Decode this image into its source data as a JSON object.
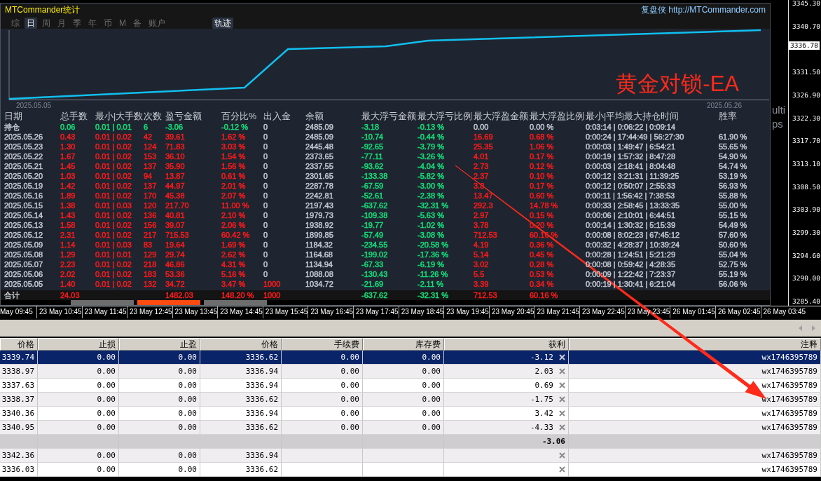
{
  "window": {
    "title": "MTCommander统计",
    "brand": "复盘侠 http://MTCommander.com"
  },
  "tabs": [
    {
      "label": "综",
      "selected": false
    },
    {
      "label": "日",
      "selected": true
    },
    {
      "label": "周",
      "selected": false
    },
    {
      "label": "月",
      "selected": false
    },
    {
      "label": "季",
      "selected": false
    },
    {
      "label": "年",
      "selected": false
    },
    {
      "label": "币",
      "selected": false
    },
    {
      "label": "M",
      "selected": false
    },
    {
      "label": "备",
      "selected": false
    },
    {
      "label": "账户",
      "selected": false
    }
  ],
  "view_tabs": [
    {
      "label": "轨迹",
      "selected": true
    }
  ],
  "equity_chart": {
    "start_label": "2025.05.05",
    "end_label": "2025.05.26",
    "overlay_text": "黄金对锁-EA"
  },
  "stats": {
    "columns": [
      "日期",
      "总手数",
      "最小|大手数",
      "次数",
      "盈亏金额",
      "百分比%",
      "出入金",
      "余额",
      "最大浮亏金额",
      "最大浮亏比例",
      "最大浮盈金额",
      "最大浮盈比例",
      "最小|平均最大持仓时间",
      "胜率"
    ],
    "rows": [
      {
        "kind": "holding",
        "cells": [
          "持仓",
          {
            "text": "0.06",
            "color": "#14e07a"
          },
          {
            "text": "0.01 | 0.01",
            "color": "#14e07a"
          },
          {
            "text": "6",
            "color": "#14e07a"
          },
          {
            "text": "-3.06",
            "color": "#14e07a"
          },
          {
            "text": "-0.12 %",
            "color": "#14e07a"
          },
          "0",
          "2485.09",
          {
            "text": "-3.18",
            "color": "#14e07a"
          },
          {
            "text": "-0.13 %",
            "color": "#14e07a"
          },
          "0.00",
          "0.00 %",
          "0:03:14 | 0:06:22 | 0:09:14"
        ]
      },
      {
        "kind": "day",
        "cells": [
          "2025.05.26",
          {
            "text": "0.43",
            "color": "#ff1a1a"
          },
          {
            "text": "0.01 | 0.02",
            "color": "#ff1a1a"
          },
          {
            "text": "42",
            "color": "#ff1a1a"
          },
          {
            "text": "39.61",
            "color": "#ff1a1a"
          },
          {
            "text": "1.62 %",
            "color": "#ff1a1a"
          },
          "0",
          "2485.09",
          {
            "text": "-10.74",
            "color": "#14e07a"
          },
          {
            "text": "-0.44 %",
            "color": "#14e07a"
          },
          {
            "text": "16.69",
            "color": "#ff1a1a"
          },
          {
            "text": "0.68 %",
            "color": "#ff1a1a"
          },
          "0:00:24 | 17:44:49 | 56:27:30",
          "61.90 %"
        ]
      },
      {
        "kind": "day",
        "cells": [
          "2025.05.23",
          {
            "text": "1.30",
            "color": "#ff1a1a"
          },
          {
            "text": "0.01 | 0.02",
            "color": "#ff1a1a"
          },
          {
            "text": "124",
            "color": "#ff1a1a"
          },
          {
            "text": "71.83",
            "color": "#ff1a1a"
          },
          {
            "text": "3.03 %",
            "color": "#ff1a1a"
          },
          "0",
          "2445.48",
          {
            "text": "-92.65",
            "color": "#14e07a"
          },
          {
            "text": "-3.79 %",
            "color": "#14e07a"
          },
          {
            "text": "25.35",
            "color": "#ff1a1a"
          },
          {
            "text": "1.06 %",
            "color": "#ff1a1a"
          },
          "0:00:03 | 1:49:47 | 6:54:21",
          "55.65 %"
        ]
      },
      {
        "kind": "day",
        "cells": [
          "2025.05.22",
          {
            "text": "1.67",
            "color": "#ff1a1a"
          },
          {
            "text": "0.01 | 0.02",
            "color": "#ff1a1a"
          },
          {
            "text": "153",
            "color": "#ff1a1a"
          },
          {
            "text": "36.10",
            "color": "#ff1a1a"
          },
          {
            "text": "1.54 %",
            "color": "#ff1a1a"
          },
          "0",
          "2373.65",
          {
            "text": "-77.11",
            "color": "#14e07a"
          },
          {
            "text": "-3.26 %",
            "color": "#14e07a"
          },
          {
            "text": "4.01",
            "color": "#ff1a1a"
          },
          {
            "text": "0.17 %",
            "color": "#ff1a1a"
          },
          "0:00:19 | 1:57:32 | 8:47:28",
          "54.90 %"
        ]
      },
      {
        "kind": "day",
        "cells": [
          "2025.05.21",
          {
            "text": "1.45",
            "color": "#ff1a1a"
          },
          {
            "text": "0.01 | 0.02",
            "color": "#ff1a1a"
          },
          {
            "text": "137",
            "color": "#ff1a1a"
          },
          {
            "text": "35.90",
            "color": "#ff1a1a"
          },
          {
            "text": "1.56 %",
            "color": "#ff1a1a"
          },
          "0",
          "2337.55",
          {
            "text": "-93.62",
            "color": "#14e07a"
          },
          {
            "text": "-4.04 %",
            "color": "#14e07a"
          },
          {
            "text": "2.73",
            "color": "#ff1a1a"
          },
          {
            "text": "0.12 %",
            "color": "#ff1a1a"
          },
          "0:00:03 | 2:18:41 | 8:04:48",
          "54.74 %"
        ]
      },
      {
        "kind": "day",
        "cells": [
          "2025.05.20",
          {
            "text": "1.03",
            "color": "#ff1a1a"
          },
          {
            "text": "0.01 | 0.02",
            "color": "#ff1a1a"
          },
          {
            "text": "94",
            "color": "#ff1a1a"
          },
          {
            "text": "13.87",
            "color": "#ff1a1a"
          },
          {
            "text": "0.61 %",
            "color": "#ff1a1a"
          },
          "0",
          "2301.65",
          {
            "text": "-133.38",
            "color": "#14e07a"
          },
          {
            "text": "-5.82 %",
            "color": "#14e07a"
          },
          {
            "text": "2.37",
            "color": "#ff1a1a"
          },
          {
            "text": "0.10 %",
            "color": "#ff1a1a"
          },
          "0:00:12 | 3:21:31 | 11:39:25",
          "53.19 %"
        ]
      },
      {
        "kind": "day",
        "cells": [
          "2025.05.19",
          {
            "text": "1.42",
            "color": "#ff1a1a"
          },
          {
            "text": "0.01 | 0.02",
            "color": "#ff1a1a"
          },
          {
            "text": "137",
            "color": "#ff1a1a"
          },
          {
            "text": "44.97",
            "color": "#ff1a1a"
          },
          {
            "text": "2.01 %",
            "color": "#ff1a1a"
          },
          "0",
          "2287.78",
          {
            "text": "-67.59",
            "color": "#14e07a"
          },
          {
            "text": "-3.00 %",
            "color": "#14e07a"
          },
          {
            "text": "3.8",
            "color": "#ff1a1a"
          },
          {
            "text": "0.17 %",
            "color": "#ff1a1a"
          },
          "0:00:12 | 0:50:07 | 2:55:33",
          "56.93 %"
        ]
      },
      {
        "kind": "day",
        "cells": [
          "2025.05.16",
          {
            "text": "1.89",
            "color": "#ff1a1a"
          },
          {
            "text": "0.01 | 0.02",
            "color": "#ff1a1a"
          },
          {
            "text": "170",
            "color": "#ff1a1a"
          },
          {
            "text": "45.38",
            "color": "#ff1a1a"
          },
          {
            "text": "2.07 %",
            "color": "#ff1a1a"
          },
          "0",
          "2242.81",
          {
            "text": "-52.61",
            "color": "#14e07a"
          },
          {
            "text": "-2.38 %",
            "color": "#14e07a"
          },
          {
            "text": "13.47",
            "color": "#ff1a1a"
          },
          {
            "text": "0.60 %",
            "color": "#ff1a1a"
          },
          "0:00:11 | 1:56:42 | 7:38:53",
          "55.88 %"
        ]
      },
      {
        "kind": "day",
        "cells": [
          "2025.05.15",
          {
            "text": "1.38",
            "color": "#ff1a1a"
          },
          {
            "text": "0.01 | 0.03",
            "color": "#ff1a1a"
          },
          {
            "text": "120",
            "color": "#ff1a1a"
          },
          {
            "text": "217.70",
            "color": "#ff1a1a"
          },
          {
            "text": "11.00 %",
            "color": "#ff1a1a"
          },
          "0",
          "2197.43",
          {
            "text": "-637.62",
            "color": "#14e07a"
          },
          {
            "text": "-32.31 %",
            "color": "#14e07a"
          },
          {
            "text": "292.3",
            "color": "#ff1a1a"
          },
          {
            "text": "14.78 %",
            "color": "#ff1a1a"
          },
          "0:00:33 | 2:58:45 | 13:33:35",
          "55.00 %"
        ]
      },
      {
        "kind": "day",
        "cells": [
          "2025.05.14",
          {
            "text": "1.43",
            "color": "#ff1a1a"
          },
          {
            "text": "0.01 | 0.02",
            "color": "#ff1a1a"
          },
          {
            "text": "136",
            "color": "#ff1a1a"
          },
          {
            "text": "40.81",
            "color": "#ff1a1a"
          },
          {
            "text": "2.10 %",
            "color": "#ff1a1a"
          },
          "0",
          "1979.73",
          {
            "text": "-109.38",
            "color": "#14e07a"
          },
          {
            "text": "-5.63 %",
            "color": "#14e07a"
          },
          {
            "text": "2.97",
            "color": "#ff1a1a"
          },
          {
            "text": "0.15 %",
            "color": "#ff1a1a"
          },
          "0:00:06 | 2:10:01 | 6:44:51",
          "55.15 %"
        ]
      },
      {
        "kind": "day",
        "cells": [
          "2025.05.13",
          {
            "text": "1.58",
            "color": "#ff1a1a"
          },
          {
            "text": "0.01 | 0.02",
            "color": "#ff1a1a"
          },
          {
            "text": "156",
            "color": "#ff1a1a"
          },
          {
            "text": "39.07",
            "color": "#ff1a1a"
          },
          {
            "text": "2.06 %",
            "color": "#ff1a1a"
          },
          "0",
          "1938.92",
          {
            "text": "-19.77",
            "color": "#14e07a"
          },
          {
            "text": "-1.02 %",
            "color": "#14e07a"
          },
          {
            "text": "3.78",
            "color": "#ff1a1a"
          },
          {
            "text": "0.20 %",
            "color": "#ff1a1a"
          },
          "0:00:14 | 1:30:32 | 5:15:39",
          "54.49 %"
        ]
      },
      {
        "kind": "day",
        "cells": [
          "2025.05.12",
          {
            "text": "2.31",
            "color": "#ff1a1a"
          },
          {
            "text": "0.01 | 0.02",
            "color": "#ff1a1a"
          },
          {
            "text": "217",
            "color": "#ff1a1a"
          },
          {
            "text": "715.53",
            "color": "#ff1a1a"
          },
          {
            "text": "60.42 %",
            "color": "#ff1a1a"
          },
          "0",
          "1899.85",
          {
            "text": "-57.49",
            "color": "#14e07a"
          },
          {
            "text": "-3.08 %",
            "color": "#14e07a"
          },
          {
            "text": "712.53",
            "color": "#ff1a1a"
          },
          {
            "text": "60.16 %",
            "color": "#ff1a1a"
          },
          "0:00:08 | 8:02:23 | 67:45:12",
          "57.60 %"
        ]
      },
      {
        "kind": "day",
        "cells": [
          "2025.05.09",
          {
            "text": "1.14",
            "color": "#ff1a1a"
          },
          {
            "text": "0.01 | 0.03",
            "color": "#ff1a1a"
          },
          {
            "text": "83",
            "color": "#ff1a1a"
          },
          {
            "text": "19.64",
            "color": "#ff1a1a"
          },
          {
            "text": "1.69 %",
            "color": "#ff1a1a"
          },
          "0",
          "1184.32",
          {
            "text": "-234.55",
            "color": "#14e07a"
          },
          {
            "text": "-20.58 %",
            "color": "#14e07a"
          },
          {
            "text": "4.19",
            "color": "#ff1a1a"
          },
          {
            "text": "0.36 %",
            "color": "#ff1a1a"
          },
          "0:00:32 | 4:28:37 | 10:39:24",
          "50.60 %"
        ]
      },
      {
        "kind": "day",
        "cells": [
          "2025.05.08",
          {
            "text": "1.29",
            "color": "#ff1a1a"
          },
          {
            "text": "0.01 | 0.01",
            "color": "#ff1a1a"
          },
          {
            "text": "129",
            "color": "#ff1a1a"
          },
          {
            "text": "29.74",
            "color": "#ff1a1a"
          },
          {
            "text": "2.62 %",
            "color": "#ff1a1a"
          },
          "0",
          "1164.68",
          {
            "text": "-199.02",
            "color": "#14e07a"
          },
          {
            "text": "-17.36 %",
            "color": "#14e07a"
          },
          {
            "text": "5.14",
            "color": "#ff1a1a"
          },
          {
            "text": "0.45 %",
            "color": "#ff1a1a"
          },
          "0:00:28 | 1:24:51 | 5:21:29",
          "55.04 %"
        ]
      },
      {
        "kind": "day",
        "cells": [
          "2025.05.07",
          {
            "text": "2.23",
            "color": "#ff1a1a"
          },
          {
            "text": "0.01 | 0.02",
            "color": "#ff1a1a"
          },
          {
            "text": "218",
            "color": "#ff1a1a"
          },
          {
            "text": "46.86",
            "color": "#ff1a1a"
          },
          {
            "text": "4.31 %",
            "color": "#ff1a1a"
          },
          "0",
          "1134.94",
          {
            "text": "-67.33",
            "color": "#14e07a"
          },
          {
            "text": "-6.19 %",
            "color": "#14e07a"
          },
          {
            "text": "3.02",
            "color": "#ff1a1a"
          },
          {
            "text": "0.28 %",
            "color": "#ff1a1a"
          },
          "0:00:08 | 0:59:42 | 4:28:35",
          "52.75 %"
        ]
      },
      {
        "kind": "day",
        "cells": [
          "2025.05.06",
          {
            "text": "2.02",
            "color": "#ff1a1a"
          },
          {
            "text": "0.01 | 0.02",
            "color": "#ff1a1a"
          },
          {
            "text": "183",
            "color": "#ff1a1a"
          },
          {
            "text": "53.36",
            "color": "#ff1a1a"
          },
          {
            "text": "5.16 %",
            "color": "#ff1a1a"
          },
          "0",
          "1088.08",
          {
            "text": "-130.43",
            "color": "#14e07a"
          },
          {
            "text": "-11.26 %",
            "color": "#14e07a"
          },
          {
            "text": "5.5",
            "color": "#ff1a1a"
          },
          {
            "text": "0.53 %",
            "color": "#ff1a1a"
          },
          "0:00:09 | 1:22:42 | 7:23:37",
          "55.19 %"
        ]
      },
      {
        "kind": "day",
        "cells": [
          "2025.05.05",
          {
            "text": "1.40",
            "color": "#ff1a1a"
          },
          {
            "text": "0.01 | 0.02",
            "color": "#ff1a1a"
          },
          {
            "text": "132",
            "color": "#ff1a1a"
          },
          {
            "text": "34.72",
            "color": "#ff1a1a"
          },
          {
            "text": "3.47 %",
            "color": "#ff1a1a"
          },
          {
            "text": "1000",
            "color": "#ff1a1a"
          },
          "1034.72",
          {
            "text": "-21.69",
            "color": "#14e07a"
          },
          {
            "text": "-2.11 %",
            "color": "#14e07a"
          },
          {
            "text": "3.39",
            "color": "#ff1a1a"
          },
          {
            "text": "0.34 %",
            "color": "#ff1a1a"
          },
          "0:00:19 | 1:30:41 | 6:21:04",
          "56.06 %"
        ]
      },
      {
        "kind": "total",
        "cells": [
          "合计",
          {
            "text": "24.03",
            "color": "#ff1a1a"
          },
          null,
          null,
          {
            "text": "1482.03",
            "color": "#ff1a1a"
          },
          {
            "text": "148.20 %",
            "color": "#ff1a1a"
          },
          {
            "text": "1000",
            "color": "#ff1a1a"
          },
          null,
          {
            "text": "-637.62",
            "color": "#14e07a"
          },
          {
            "text": "-32.31 %",
            "color": "#14e07a"
          },
          {
            "text": "712.53",
            "color": "#ff1a1a"
          },
          {
            "text": "60.16 %",
            "color": "#ff1a1a"
          }
        ]
      }
    ]
  },
  "scroll_segments": [
    {
      "selected": false
    },
    {
      "selected": true
    },
    {
      "selected": false
    }
  ],
  "chart_fragments": [
    "ulti",
    "ps"
  ],
  "price_axis": {
    "labels": [
      "3345.30",
      "3340.70",
      "3331.50",
      "3326.90",
      "3322.30",
      "3317.70",
      "3313.10",
      "3308.50",
      "3303.90",
      "3299.30",
      "3294.60",
      "3290.00",
      "3285.40"
    ],
    "current_price": "3336.78"
  },
  "time_axis": [
    "May 09:45",
    "23 May 10:45",
    "23 May 11:45",
    "23 May 12:45",
    "23 May 13:45",
    "23 May 14:45",
    "23 May 15:45",
    "23 May 16:45",
    "23 May 17:45",
    "23 May 18:45",
    "23 May 19:45",
    "23 May 20:45",
    "23 May 21:45",
    "23 May 22:45",
    "23 May 23:45",
    "26 May 01:45",
    "26 May 02:45",
    "26 May 03:45"
  ],
  "trades": {
    "columns": [
      "价格",
      "止损",
      "止盈",
      "价格",
      "手续费",
      "库存费",
      "获利",
      "注释"
    ],
    "rows": [
      {
        "kind": "position",
        "selected": true,
        "cells": [
          "3339.74",
          "0.00",
          "0.00",
          "3336.62",
          "0.00",
          "0.00",
          "-3.12",
          "wx1746395789"
        ]
      },
      {
        "kind": "position",
        "selected": false,
        "cells": [
          "3338.97",
          "0.00",
          "0.00",
          "3336.94",
          "0.00",
          "0.00",
          "2.03",
          "wx1746395789"
        ]
      },
      {
        "kind": "position",
        "selected": false,
        "cells": [
          "3337.63",
          "0.00",
          "0.00",
          "3336.94",
          "0.00",
          "0.00",
          "0.69",
          "wx1746395789"
        ]
      },
      {
        "kind": "position",
        "selected": false,
        "cells": [
          "3338.37",
          "0.00",
          "0.00",
          "3336.62",
          "0.00",
          "0.00",
          "-1.75",
          "wx1746395789"
        ]
      },
      {
        "kind": "position",
        "selected": false,
        "cells": [
          "3340.36",
          "0.00",
          "0.00",
          "3336.94",
          "0.00",
          "0.00",
          "3.42",
          "wx1746395789"
        ]
      },
      {
        "kind": "position",
        "selected": false,
        "cells": [
          "3340.95",
          "0.00",
          "0.00",
          "3336.62",
          "0.00",
          "0.00",
          "-4.33",
          "wx1746395789"
        ]
      },
      {
        "kind": "summary",
        "selected": false,
        "cells": [
          null,
          null,
          null,
          null,
          null,
          null,
          "-3.06",
          null
        ]
      },
      {
        "kind": "order",
        "selected": false,
        "cells": [
          "3342.36",
          "0.00",
          "0.00",
          "3336.94",
          null,
          null,
          null,
          "wx1746395789"
        ]
      },
      {
        "kind": "order",
        "selected": false,
        "cells": [
          "3336.03",
          "0.00",
          "0.00",
          "3336.62",
          null,
          null,
          null,
          "wx1746395789"
        ]
      }
    ]
  }
}
